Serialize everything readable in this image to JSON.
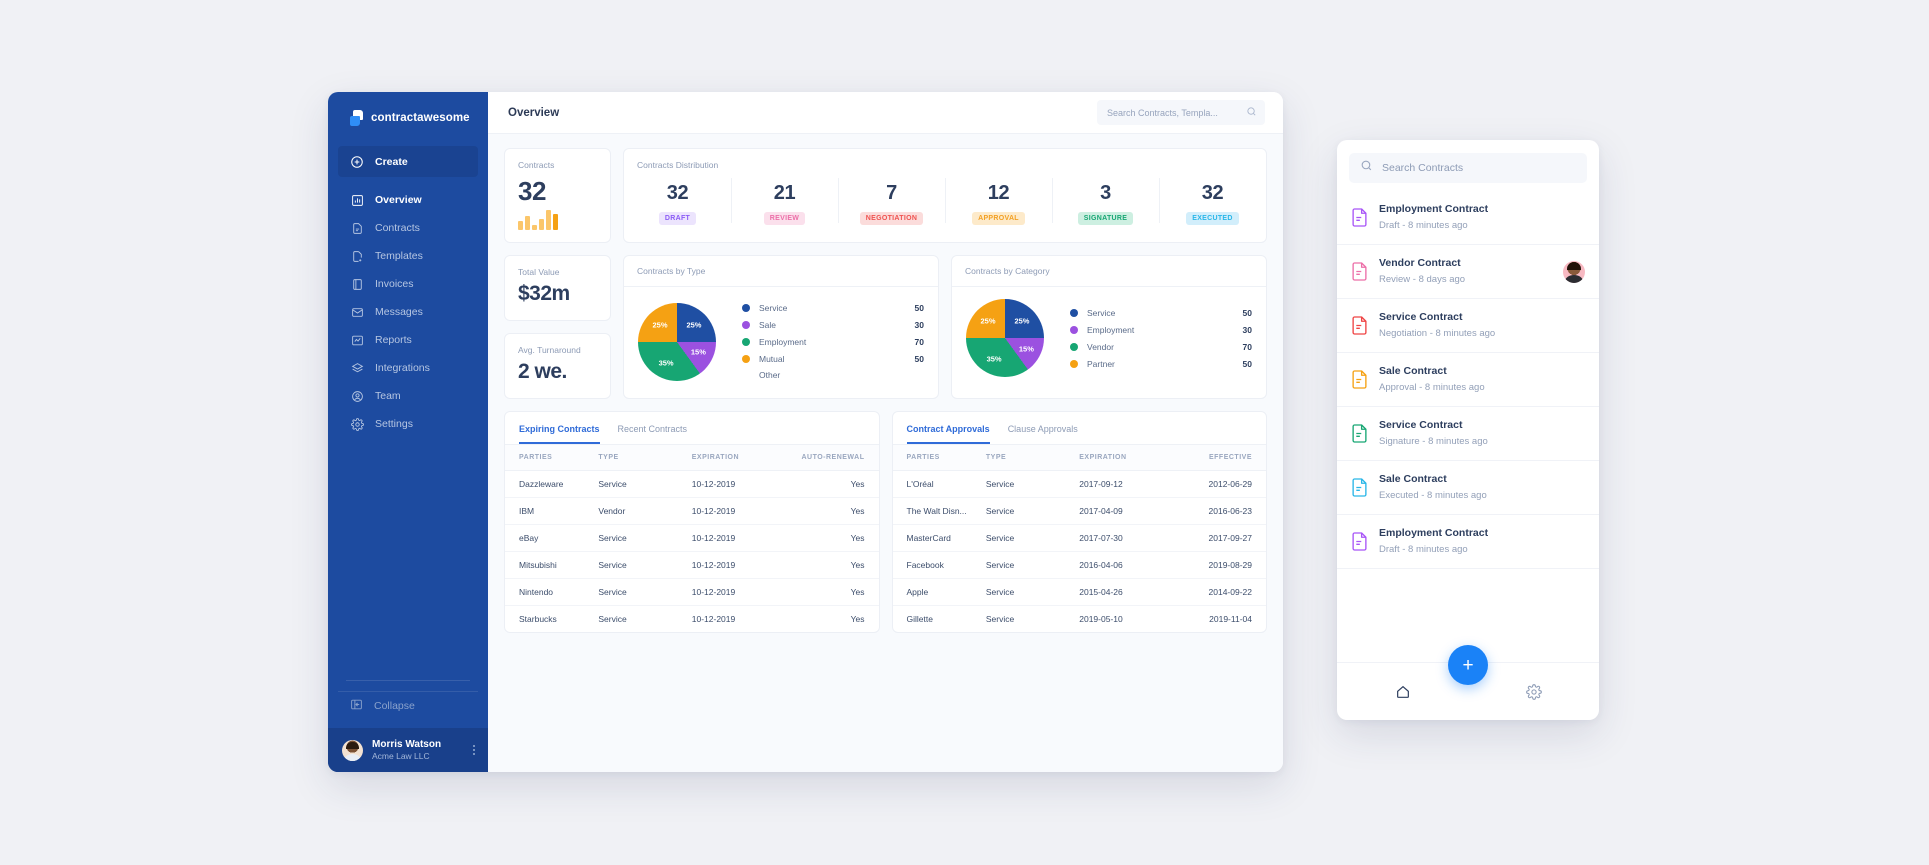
{
  "brand": {
    "name": "contractawesome"
  },
  "sidebar": {
    "create_label": "Create",
    "items": [
      {
        "label": "Overview",
        "icon": "chart-bar-icon"
      },
      {
        "label": "Contracts",
        "icon": "document-icon"
      },
      {
        "label": "Templates",
        "icon": "template-icon"
      },
      {
        "label": "Invoices",
        "icon": "invoice-icon"
      },
      {
        "label": "Messages",
        "icon": "envelope-icon"
      },
      {
        "label": "Reports",
        "icon": "report-chart-icon"
      },
      {
        "label": "Integrations",
        "icon": "layers-icon"
      },
      {
        "label": "Team",
        "icon": "user-circle-icon"
      },
      {
        "label": "Settings",
        "icon": "gear-icon"
      }
    ],
    "collapse_label": "Collapse",
    "user": {
      "name": "Morris Watson",
      "org": "Acme Law LLC"
    }
  },
  "topbar": {
    "title": "Overview",
    "search_placeholder": "Search Contracts, Templa..."
  },
  "kpis": {
    "contracts": {
      "title": "Contracts",
      "value": "32"
    },
    "total_value": {
      "title": "Total Value",
      "value": "$32m"
    },
    "turnaround": {
      "title": "Avg. Turnaround",
      "value": "2 we."
    }
  },
  "distribution": {
    "title": "Contracts Distribution",
    "cells": [
      {
        "value": "32",
        "label": "DRAFT",
        "fg": "#8b5cf6",
        "bg": "#ece4fd"
      },
      {
        "value": "21",
        "label": "REVIEW",
        "fg": "#ec6fa8",
        "bg": "#fbe0ec"
      },
      {
        "value": "7",
        "label": "NEGOTIATION",
        "fg": "#ef5350",
        "bg": "#fbdcdb"
      },
      {
        "value": "12",
        "label": "APPROVAL",
        "fg": "#f2a024",
        "bg": "#fdeaca"
      },
      {
        "value": "3",
        "label": "SIGNATURE",
        "fg": "#17a673",
        "bg": "#cdefe1"
      },
      {
        "value": "32",
        "label": "EXECUTED",
        "fg": "#29b6e8",
        "bg": "#d2eefb"
      }
    ]
  },
  "minibars": {
    "heights": [
      9,
      14,
      5,
      11,
      20,
      16
    ],
    "color": "#fbc66a",
    "last_color": "#f5a113"
  },
  "chart_data": [
    {
      "type": "pie",
      "title": "Contracts by Type",
      "categories": [
        "Service",
        "Sale",
        "Employment",
        "Mutual"
      ],
      "values": [
        50,
        30,
        70,
        50
      ],
      "percents": [
        "25%",
        "15%",
        "35%",
        "25%"
      ],
      "colors": [
        "#1f4fa3",
        "#9b51e0",
        "#17a673",
        "#f5a113"
      ],
      "extra_legend": "Other",
      "legend_position": "right"
    },
    {
      "type": "pie",
      "title": "Contracts by Category",
      "categories": [
        "Service",
        "Employment",
        "Vendor",
        "Partner"
      ],
      "values": [
        50,
        30,
        70,
        50
      ],
      "percents": [
        "25%",
        "15%",
        "35%",
        "25%"
      ],
      "colors": [
        "#1f4fa3",
        "#9b51e0",
        "#17a673",
        "#f5a113"
      ],
      "legend_position": "right"
    }
  ],
  "left_table": {
    "tabs": [
      {
        "label": "Expiring Contracts",
        "active": true
      },
      {
        "label": "Recent Contracts",
        "active": false
      }
    ],
    "columns": [
      "PARTIES",
      "TYPE",
      "EXPIRATION",
      "AUTO-RENEWAL"
    ],
    "rows": [
      [
        "Dazzleware",
        "Service",
        "10-12-2019",
        "Yes"
      ],
      [
        "IBM",
        "Vendor",
        "10-12-2019",
        "Yes"
      ],
      [
        "eBay",
        "Service",
        "10-12-2019",
        "Yes"
      ],
      [
        "Mitsubishi",
        "Service",
        "10-12-2019",
        "Yes"
      ],
      [
        "Nintendo",
        "Service",
        "10-12-2019",
        "Yes"
      ],
      [
        "Starbucks",
        "Service",
        "10-12-2019",
        "Yes"
      ]
    ]
  },
  "right_table": {
    "tabs": [
      {
        "label": "Contract Approvals",
        "active": true
      },
      {
        "label": "Clause Approvals",
        "active": false
      }
    ],
    "columns": [
      "PARTIES",
      "TYPE",
      "EXPIRATION",
      "EFFECTIVE"
    ],
    "rows": [
      [
        "L'Oréal",
        "Service",
        "2017-09-12",
        "2012-06-29"
      ],
      [
        "The Walt Disn...",
        "Service",
        "2017-04-09",
        "2016-06-23"
      ],
      [
        "MasterCard",
        "Service",
        "2017-07-30",
        "2017-09-27"
      ],
      [
        "Facebook",
        "Service",
        "2016-04-06",
        "2019-08-29"
      ],
      [
        "Apple",
        "Service",
        "2015-04-26",
        "2014-09-22"
      ],
      [
        "Gillette",
        "Service",
        "2019-05-10",
        "2019-11-04"
      ]
    ]
  },
  "mobile": {
    "search_placeholder": "Search Contracts",
    "items": [
      {
        "title": "Employment Contract",
        "sub": "Draft - 8 minutes ago",
        "color": "#a855f7",
        "avatar": false
      },
      {
        "title": "Vendor Contract",
        "sub": "Review - 8 days ago",
        "color": "#ec6fa8",
        "avatar": true
      },
      {
        "title": "Service Contract",
        "sub": "Negotiation - 8 minutes ago",
        "color": "#ef4444",
        "avatar": false
      },
      {
        "title": "Sale Contract",
        "sub": "Approval - 8 minutes ago",
        "color": "#f5a113",
        "avatar": false
      },
      {
        "title": "Service Contract",
        "sub": "Signature - 8 minutes ago",
        "color": "#17a673",
        "avatar": false
      },
      {
        "title": "Sale Contract",
        "sub": "Executed - 8 minutes ago",
        "color": "#29b6e8",
        "avatar": false
      },
      {
        "title": "Employment Contract",
        "sub": "Draft - 8 minutes ago",
        "color": "#a855f7",
        "avatar": false
      }
    ],
    "fab_label": "+",
    "nav": [
      {
        "icon": "home-icon"
      },
      {
        "icon": "gear-icon"
      }
    ]
  }
}
